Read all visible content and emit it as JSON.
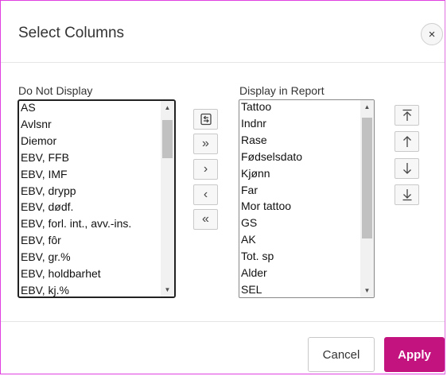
{
  "dialog": {
    "title": "Select Columns",
    "close_label": "×"
  },
  "do_not_display": {
    "label": "Do Not Display",
    "items": [
      "AS",
      "Avlsnr",
      "Diemor",
      "EBV, FFB",
      "EBV, IMF",
      "EBV, drypp",
      "EBV, dødf.",
      "EBV, forl. int., avv.-ins.",
      "EBV, fôr",
      "EBV, gr.%",
      "EBV, holdbarhet",
      "EBV, kj.%"
    ]
  },
  "display_in_report": {
    "label": "Display in Report",
    "items": [
      "Tattoo",
      "Indnr",
      "Rase",
      "Fødselsdato",
      "Kjønn",
      "Far",
      "Mor tattoo",
      "GS",
      "AK",
      "Tot. sp",
      "Alder",
      "SEL"
    ]
  },
  "transfer_buttons": {
    "reset": "reset-icon",
    "add_all": "»",
    "add": "›",
    "remove": "‹",
    "remove_all": "«"
  },
  "order_buttons": {
    "move_top": "move-top-icon",
    "move_up": "move-up-icon",
    "move_down": "move-down-icon",
    "move_bottom": "move-bottom-icon"
  },
  "footer": {
    "cancel_label": "Cancel",
    "apply_label": "Apply"
  },
  "colors": {
    "accent": "#c2137f",
    "dialog_border": "#e040e0"
  }
}
